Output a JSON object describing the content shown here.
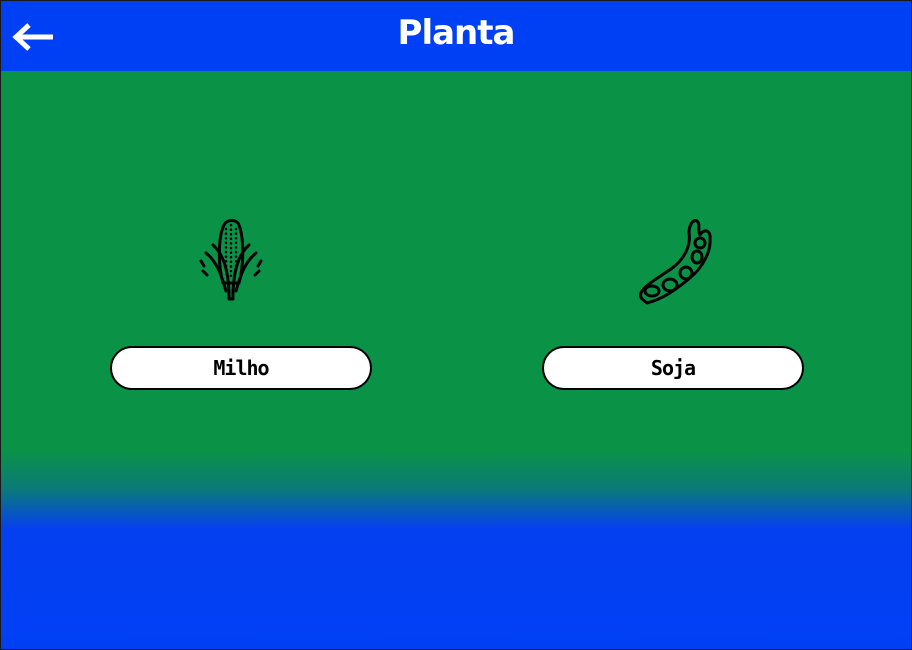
{
  "header": {
    "title": "Planta",
    "back_icon": "arrow-left-icon"
  },
  "options": [
    {
      "label": "Milho",
      "icon": "corn-icon"
    },
    {
      "label": "Soja",
      "icon": "soybean-icon"
    }
  ],
  "colors": {
    "header_bg": "#0040f5",
    "body_green": "#0a9346",
    "footer_blue": "#0040f5",
    "button_bg": "#ffffff",
    "button_border": "#000000"
  }
}
